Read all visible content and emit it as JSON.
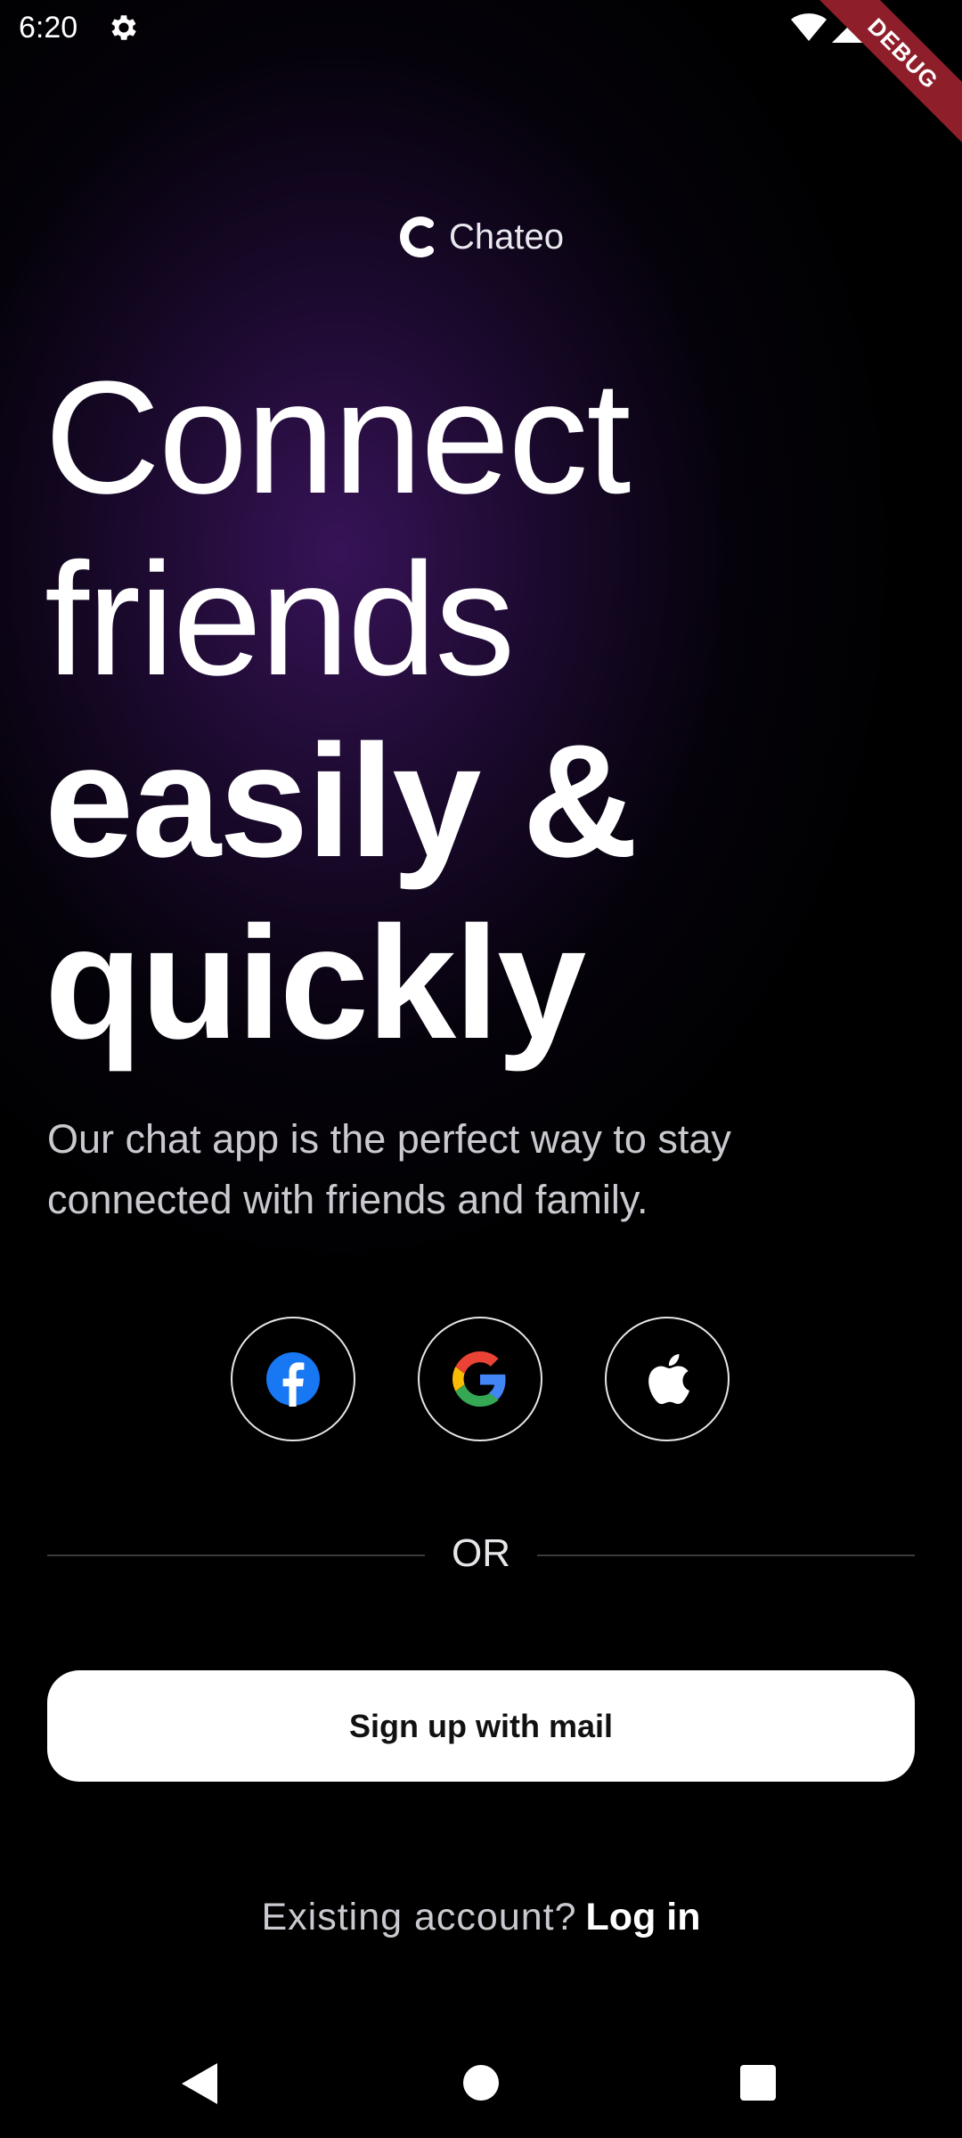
{
  "status_bar": {
    "time": "6:20",
    "icons": [
      "settings-icon",
      "wifi-icon",
      "signal-icon",
      "battery-icon"
    ],
    "debug_label": "DEBUG"
  },
  "logo": {
    "text": "Chateo",
    "icon": "chateo-logo-icon"
  },
  "headline": {
    "line1": "Connect",
    "line2": "friends",
    "line3": "easily &",
    "line4": "quickly"
  },
  "subtitle": "Our chat app is the perfect way to stay connected with friends and family.",
  "social": [
    {
      "name": "facebook",
      "icon": "facebook-icon",
      "color": "#1877F2"
    },
    {
      "name": "google",
      "icon": "google-icon",
      "colors": [
        "#4285F4",
        "#EA4335",
        "#FBBC05",
        "#34A853"
      ]
    },
    {
      "name": "apple",
      "icon": "apple-icon",
      "color": "#ffffff"
    }
  ],
  "divider_text": "OR",
  "signup_button": "Sign up with mail",
  "login": {
    "prompt": "Existing account?",
    "link": "Log in"
  },
  "nav": [
    "back-icon",
    "home-icon",
    "recents-icon"
  ],
  "colors": {
    "background": "#000000",
    "glow": "#3a145c",
    "button_bg": "#ffffff",
    "debug_banner": "#8e1f2a"
  }
}
